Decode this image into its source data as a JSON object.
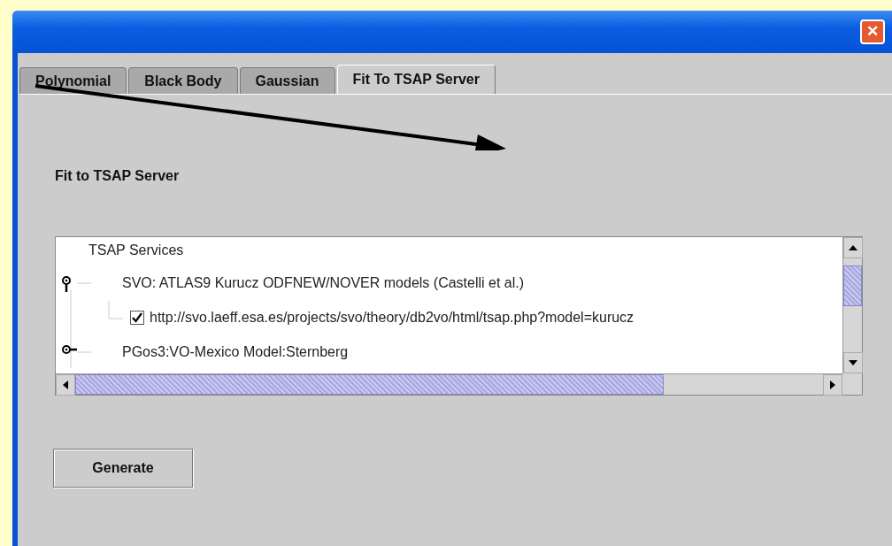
{
  "window": {
    "close": "✕"
  },
  "tabs": [
    {
      "label": "Polynomial",
      "selected": false
    },
    {
      "label": "Black Body",
      "selected": false
    },
    {
      "label": "Gaussian",
      "selected": false
    },
    {
      "label": "Fit To TSAP Server",
      "selected": true
    }
  ],
  "heading": "Fit to TSAP Server",
  "tree": {
    "label": "TSAP Services",
    "children": [
      {
        "kind": "folder",
        "label": "SVO: ATLAS9 Kurucz ODFNEW/NOVER models (Castelli et al.)",
        "expanded": true,
        "children": [
          {
            "kind": "checkbox",
            "label": "http://svo.laeff.esa.es/projects/svo/theory/db2vo/html/tsap.php?model=kurucz",
            "checked": true
          }
        ]
      },
      {
        "kind": "folder",
        "label": "PGos3:VO-Mexico Model:Sternberg",
        "expanded": false
      }
    ]
  },
  "buttons": [
    "Generate"
  ]
}
